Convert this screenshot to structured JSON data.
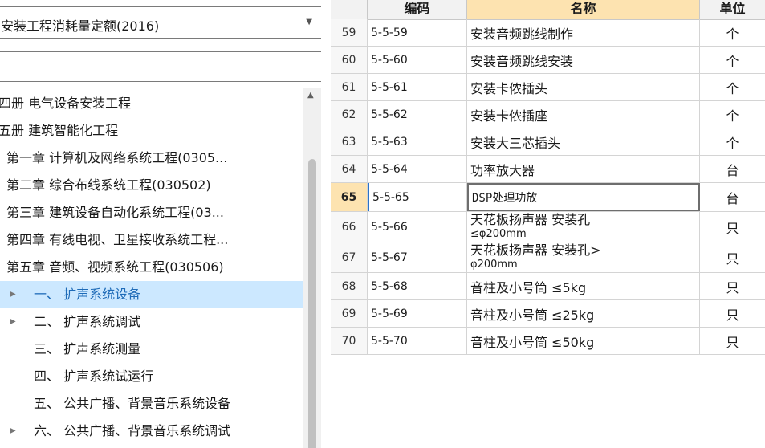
{
  "quota_selector": {
    "value": "安装工程消耗量定额(2016)"
  },
  "search": {
    "value": ""
  },
  "tree": {
    "items": [
      {
        "label": "四册  电气设备安装工程",
        "indent": 0,
        "caret": false,
        "selected": false
      },
      {
        "label": "五册  建筑智能化工程",
        "indent": 0,
        "caret": false,
        "selected": false
      },
      {
        "label": "第一章  计算机及网络系统工程(0305...",
        "indent": 1,
        "caret": false,
        "selected": false
      },
      {
        "label": "第二章  综合布线系统工程(030502)",
        "indent": 1,
        "caret": false,
        "selected": false
      },
      {
        "label": "第三章  建筑设备自动化系统工程(03...",
        "indent": 1,
        "caret": false,
        "selected": false
      },
      {
        "label": "第四章  有线电视、卫星接收系统工程...",
        "indent": 1,
        "caret": false,
        "selected": false
      },
      {
        "label": "第五章  音频、视频系统工程(030506)",
        "indent": 1,
        "caret": false,
        "selected": false
      },
      {
        "label": "一、  扩声系统设备",
        "indent": 2,
        "caret": true,
        "selected": true
      },
      {
        "label": "二、  扩声系统调试",
        "indent": 2,
        "caret": true,
        "selected": false
      },
      {
        "label": "三、  扩声系统测量",
        "indent": 2,
        "caret": false,
        "selected": false
      },
      {
        "label": "四、  扩声系统试运行",
        "indent": 2,
        "caret": false,
        "selected": false
      },
      {
        "label": "五、  公共广播、背景音乐系统设备",
        "indent": 2,
        "caret": false,
        "selected": false
      },
      {
        "label": "六、  公共广播、背景音乐系统调试",
        "indent": 2,
        "caret": true,
        "selected": false
      }
    ]
  },
  "table": {
    "columns": {
      "code": "编码",
      "name": "名称",
      "unit": "单位"
    },
    "current_index": "65",
    "rows": [
      {
        "idx": "59",
        "code": "5-5-59",
        "name": "安装音频跳线制作",
        "name2": "",
        "unit": "个"
      },
      {
        "idx": "60",
        "code": "5-5-60",
        "name": "安装音频跳线安装",
        "name2": "",
        "unit": "个"
      },
      {
        "idx": "61",
        "code": "5-5-61",
        "name": "安装卡侬插头",
        "name2": "",
        "unit": "个"
      },
      {
        "idx": "62",
        "code": "5-5-62",
        "name": "安装卡侬插座",
        "name2": "",
        "unit": "个"
      },
      {
        "idx": "63",
        "code": "5-5-63",
        "name": "安装大三芯插头",
        "name2": "",
        "unit": "个"
      },
      {
        "idx": "64",
        "code": "5-5-64",
        "name": "功率放大器",
        "name2": "",
        "unit": "台"
      },
      {
        "idx": "65",
        "code": "5-5-65",
        "name": "DSP处理功放",
        "name2": "",
        "unit": "台"
      },
      {
        "idx": "66",
        "code": "5-5-66",
        "name": "天花板扬声器 安装孔",
        "name2": "≤φ200mm",
        "unit": "只"
      },
      {
        "idx": "67",
        "code": "5-5-67",
        "name": "天花板扬声器 安装孔>",
        "name2": "φ200mm",
        "unit": "只"
      },
      {
        "idx": "68",
        "code": "5-5-68",
        "name": "音柱及小号筒 ≤5kg",
        "name2": "",
        "unit": "只"
      },
      {
        "idx": "69",
        "code": "5-5-69",
        "name": "音柱及小号筒 ≤25kg",
        "name2": "",
        "unit": "只"
      },
      {
        "idx": "70",
        "code": "5-5-70",
        "name": "音柱及小号筒 ≤50kg",
        "name2": "",
        "unit": "只"
      }
    ]
  },
  "icons": {
    "dropdown": "chevron-down-icon",
    "tree_caret": "caret-right-icon",
    "scroll_up": "scroll-up-arrow-icon"
  },
  "colors": {
    "tree_selected_bg": "#cce8ff",
    "tree_selected_text": "#1e6bb8",
    "name_header_bg": "#fde3b0",
    "current_row_index_bg": "#fde3b0"
  }
}
